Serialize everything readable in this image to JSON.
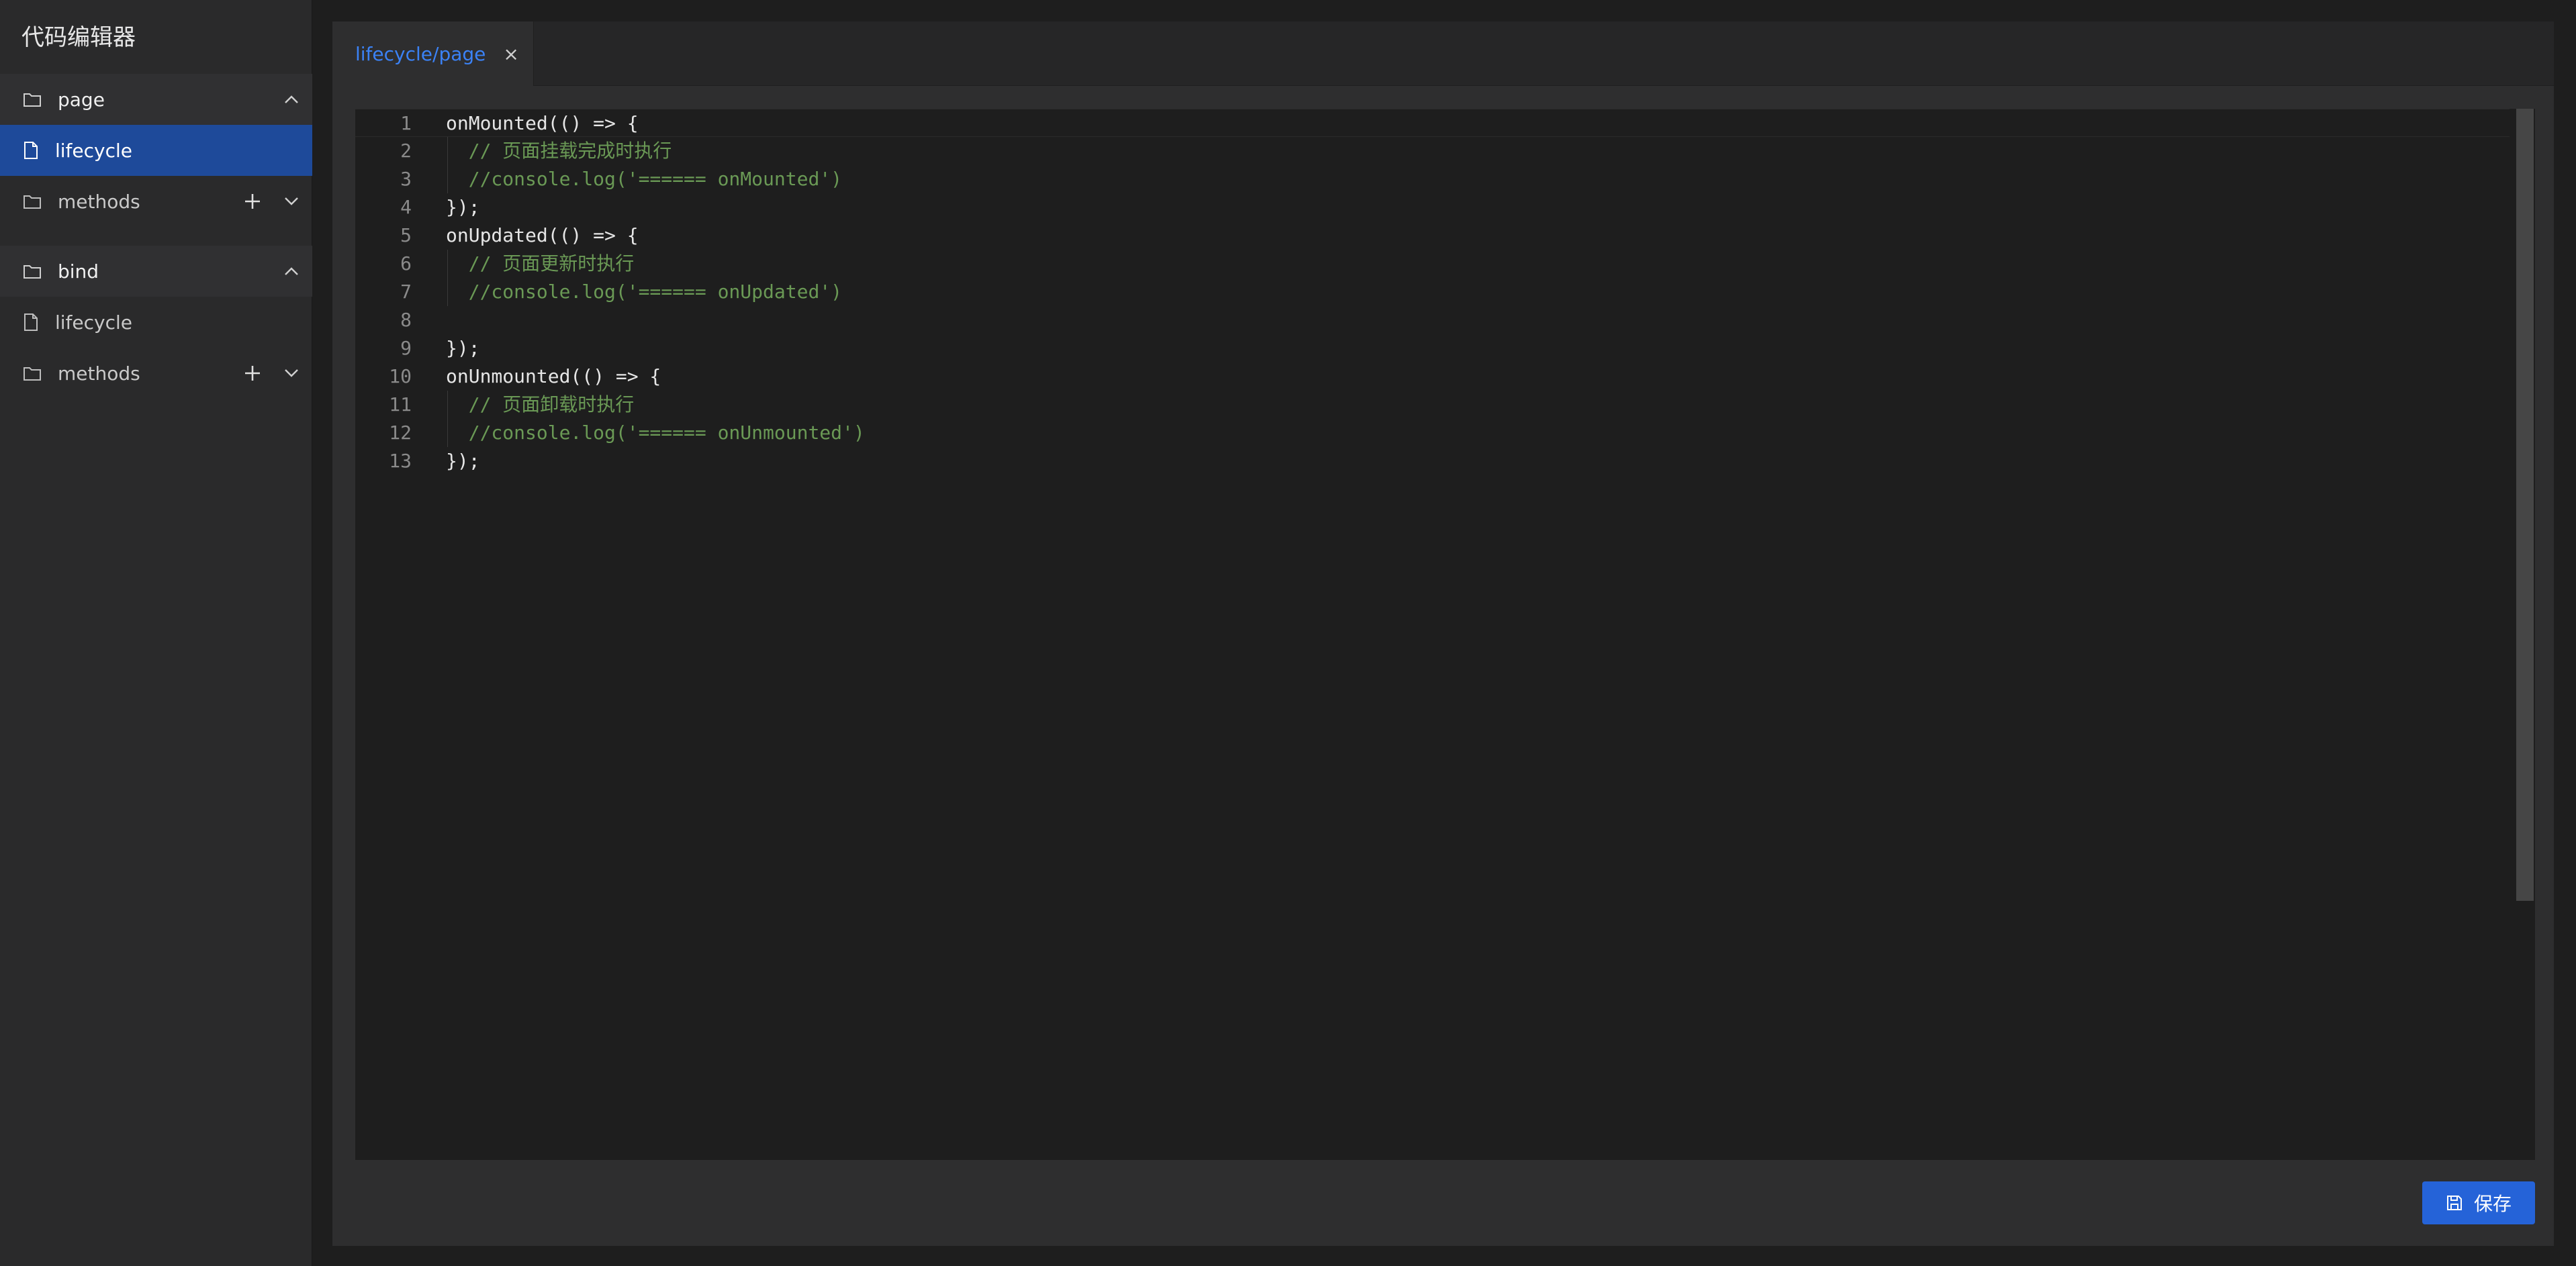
{
  "app": {
    "title": "代码编辑器"
  },
  "sidebar": {
    "groups": [
      {
        "label": "page",
        "items": [
          {
            "label": "lifecycle",
            "active": true
          },
          {
            "label": "methods"
          }
        ]
      },
      {
        "label": "bind",
        "items": [
          {
            "label": "lifecycle",
            "active": false
          },
          {
            "label": "methods"
          }
        ]
      }
    ]
  },
  "tabs": [
    {
      "label": "lifecycle/page",
      "close": "×"
    }
  ],
  "editor": {
    "lines": [
      {
        "n": "1",
        "text": "onMounted(() => {",
        "type": "code"
      },
      {
        "n": "2",
        "text": "  // 页面挂载完成时执行",
        "type": "comment"
      },
      {
        "n": "3",
        "text": "  //console.log('====== onMounted')",
        "type": "comment"
      },
      {
        "n": "4",
        "text": "});",
        "type": "code"
      },
      {
        "n": "5",
        "text": "onUpdated(() => {",
        "type": "code"
      },
      {
        "n": "6",
        "text": "  // 页面更新时执行",
        "type": "comment"
      },
      {
        "n": "7",
        "text": "  //console.log('====== onUpdated')",
        "type": "comment"
      },
      {
        "n": "8",
        "text": "",
        "type": "code"
      },
      {
        "n": "9",
        "text": "});",
        "type": "code"
      },
      {
        "n": "10",
        "text": "onUnmounted(() => {",
        "type": "code"
      },
      {
        "n": "11",
        "text": "  // 页面卸载时执行",
        "type": "comment"
      },
      {
        "n": "12",
        "text": "  //console.log('====== onUnmounted')",
        "type": "comment"
      },
      {
        "n": "13",
        "text": "});",
        "type": "code"
      }
    ]
  },
  "actions": {
    "save_label": "保存"
  },
  "colors": {
    "accent": "#2563d8",
    "active_item_bg": "#1e4a9a",
    "comment": "#6a9955",
    "tab_label": "#3b82f6"
  },
  "icons": {
    "folder": "folder-icon",
    "file": "file-icon",
    "chevron_up": "chevron-up-icon",
    "chevron_down": "chevron-down-icon",
    "plus": "plus-icon",
    "save": "save-icon"
  }
}
